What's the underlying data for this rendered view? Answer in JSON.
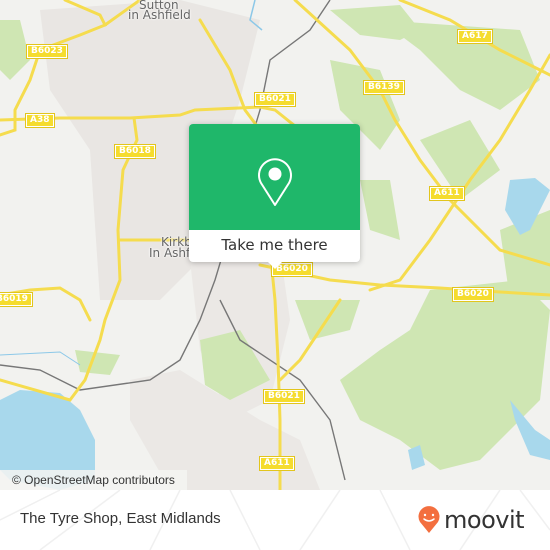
{
  "map": {
    "places": [
      {
        "name": "sutton",
        "text": "Sutton"
      },
      {
        "name": "in-ashfield",
        "text": "in Ashfield"
      },
      {
        "name": "kirkby",
        "text": "Kirkby"
      },
      {
        "name": "in-ashfield-2",
        "text": "In Ashfield"
      }
    ],
    "road_labels": {
      "b6023": "B6023",
      "a38": "A38",
      "b6018": "B6018",
      "b6021_top": "B6021",
      "b6139": "B6139",
      "a617": "A617",
      "a611_top": "A611",
      "b6020_center": "B6020",
      "b6020_right": "B6020",
      "b6019": "B6019",
      "b6021_bottom": "B6021",
      "a611_bottom": "A611"
    },
    "attribution": "© OpenStreetMap contributors"
  },
  "popup": {
    "icon": "map-pin-icon",
    "button_label": "Take me there"
  },
  "footer": {
    "place_name": "The Tyre Shop, East Midlands",
    "brand": "moovit",
    "brand_color": "#f36f3f",
    "accent_color": "#1fb76a"
  }
}
